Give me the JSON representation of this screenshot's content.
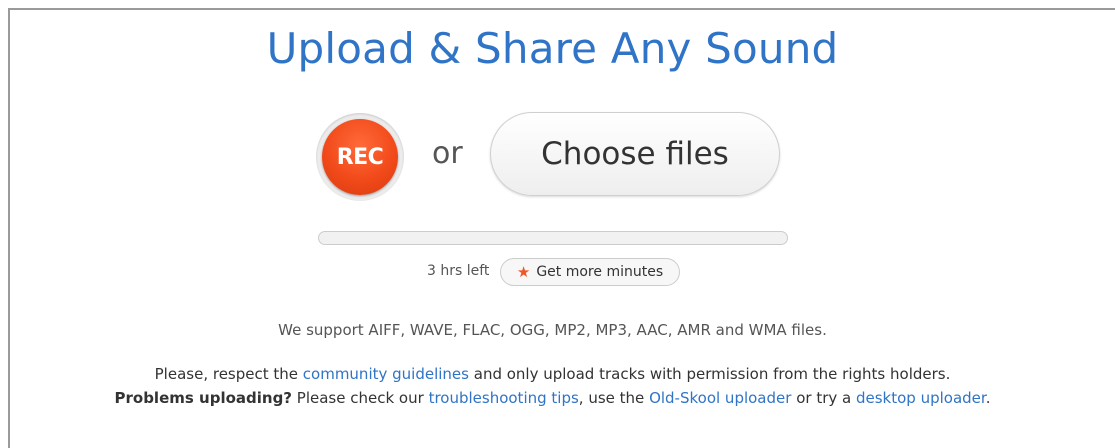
{
  "header": {
    "title": "Upload & Share Any Sound"
  },
  "actions": {
    "rec_label": "REC",
    "or_text": "or",
    "choose_label": "Choose files"
  },
  "quota": {
    "progress": 0.0,
    "time_left": "3 hrs left",
    "more_label": "Get more minutes",
    "star_icon": "star-icon"
  },
  "info": {
    "formats": "We support AIFF, WAVE, FLAC, OGG, MP2, MP3, AAC, AMR and WMA files.",
    "line1_a": "Please, respect the",
    "line1_link": "community guidelines",
    "line1_b": "and only upload tracks with permission from the rights holders.",
    "line2_bold": "Problems uploading?",
    "line2_a": "Please check our",
    "line2_link1": "troubleshooting tips",
    "line2_b": ", use the",
    "line2_link2": "Old-Skool uploader",
    "line2_c": "or try a",
    "line2_link3": "desktop uploader",
    "line2_d": "."
  },
  "colors": {
    "accent": "#2f74c6",
    "rec": "#f24a1a",
    "border": "#9a9a9a"
  }
}
